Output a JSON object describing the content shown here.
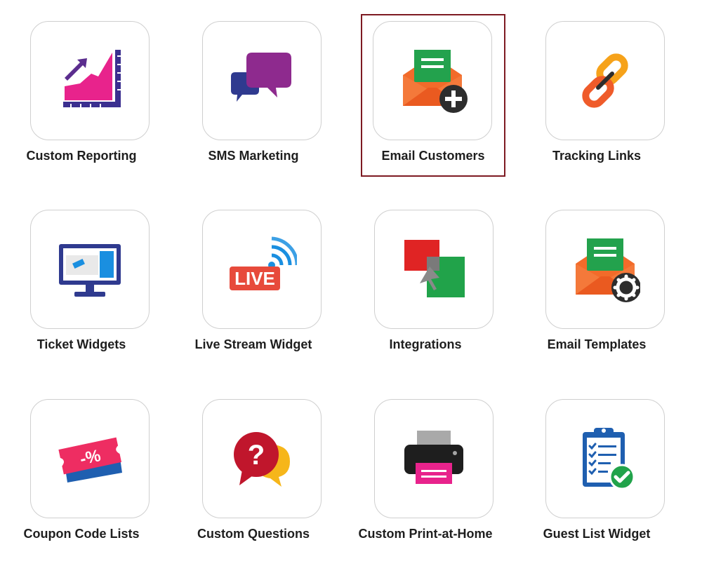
{
  "tiles": [
    {
      "label": "Custom Reporting",
      "icon": "chart-icon"
    },
    {
      "label": "SMS Marketing",
      "icon": "chat-bubbles-icon"
    },
    {
      "label": "Email Customers",
      "icon": "email-add-icon",
      "selected": true
    },
    {
      "label": "Tracking Links",
      "icon": "link-icon"
    },
    {
      "label": "Ticket Widgets",
      "icon": "monitor-icon"
    },
    {
      "label": "Live Stream Widget",
      "icon": "live-broadcast-icon"
    },
    {
      "label": "Integrations",
      "icon": "integrations-icon"
    },
    {
      "label": "Email Templates",
      "icon": "email-settings-icon"
    },
    {
      "label": "Coupon Code Lists",
      "icon": "coupon-icon"
    },
    {
      "label": "Custom Questions",
      "icon": "question-bubble-icon"
    },
    {
      "label": "Custom Print-at-Home",
      "icon": "printer-icon"
    },
    {
      "label": "Guest List Widget",
      "icon": "clipboard-check-icon"
    }
  ],
  "icon_text": {
    "live": "LIVE",
    "discount": "-%",
    "question": "?"
  },
  "colors": {
    "selected_border": "#7d1a22",
    "tile_border": "#cfcfcf",
    "label_text": "#1e1e1e"
  }
}
